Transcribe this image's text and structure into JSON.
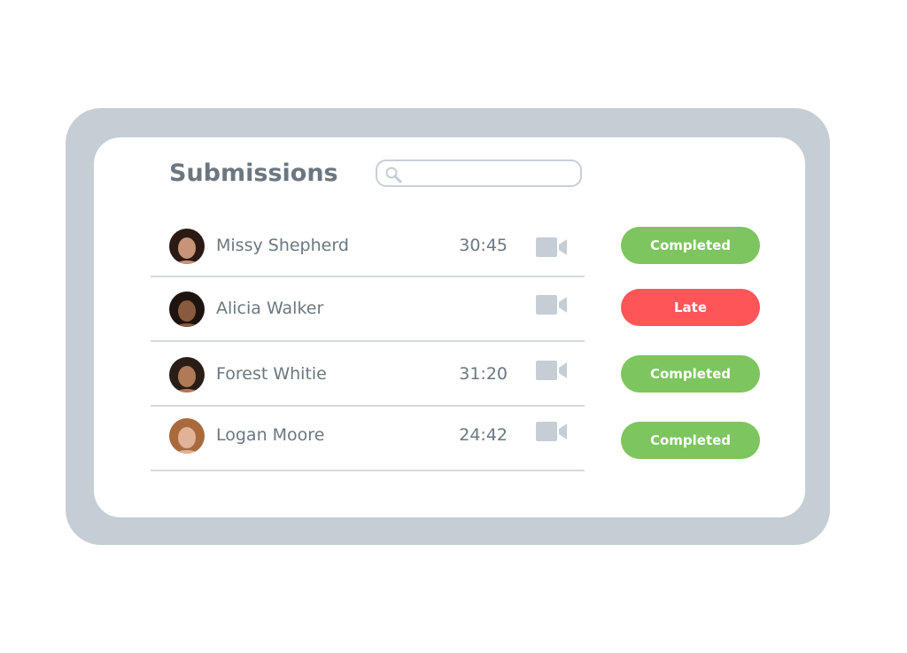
{
  "header": {
    "title": "Submissions",
    "search": {
      "value": "",
      "placeholder": ""
    }
  },
  "colors": {
    "frame": "#c5cdd5",
    "completed": "#7dc55e",
    "late": "#fe5558",
    "text": "#6b7780",
    "icon": "#c5cdd5"
  },
  "rows": [
    {
      "name": "Missy Shepherd",
      "time": "30:45",
      "status": "Completed",
      "avatar_skin": "#c89478",
      "avatar_hair": "#2b1a14"
    },
    {
      "name": "Alicia Walker",
      "time": "",
      "status": "Late",
      "avatar_skin": "#8a5a3c",
      "avatar_hair": "#1d1410"
    },
    {
      "name": "Forest Whitie",
      "time": "31:20",
      "status": "Completed",
      "avatar_skin": "#b07a58",
      "avatar_hair": "#2a1d16"
    },
    {
      "name": "Logan Moore",
      "time": "24:42",
      "status": "Completed",
      "avatar_skin": "#e2b298",
      "avatar_hair": "#a86a3c"
    }
  ]
}
